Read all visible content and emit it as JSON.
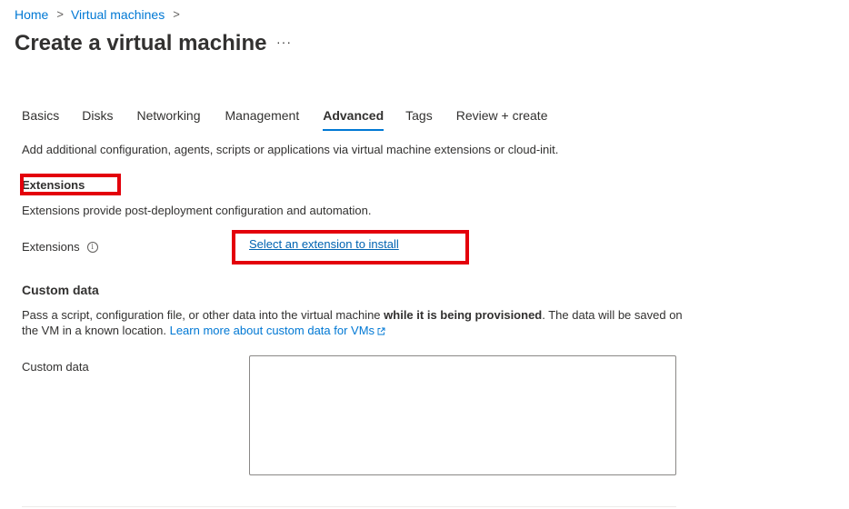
{
  "breadcrumb": {
    "items": [
      "Home",
      "Virtual machines"
    ],
    "separator": ">"
  },
  "page": {
    "title": "Create a virtual machine",
    "more_label": "···"
  },
  "tabs": [
    {
      "label": "Basics",
      "selected": false
    },
    {
      "label": "Disks",
      "selected": false
    },
    {
      "label": "Networking",
      "selected": false
    },
    {
      "label": "Management",
      "selected": false
    },
    {
      "label": "Advanced",
      "selected": true
    },
    {
      "label": "Tags",
      "selected": false
    },
    {
      "label": "Review + create",
      "selected": false
    }
  ],
  "intro": "Add additional configuration, agents, scripts or applications via virtual machine extensions or cloud-init.",
  "extensions": {
    "heading": "Extensions",
    "description": "Extensions provide post-deployment configuration and automation.",
    "label": "Extensions",
    "info_icon": "info-icon",
    "link": "Select an extension to install"
  },
  "custom_data": {
    "heading": "Custom data",
    "description_pre": "Pass a script, configuration file, or other data into the virtual machine ",
    "description_bold": "while it is being provisioned",
    "description_post": ". The data will be saved on the VM in a known location. ",
    "learn_more": "Learn more about custom data for VMs",
    "learn_more_icon": "external-link-icon",
    "label": "Custom data",
    "value": ""
  },
  "colors": {
    "accent": "#0078d4",
    "highlight": "#e3000b",
    "text": "#323130"
  }
}
